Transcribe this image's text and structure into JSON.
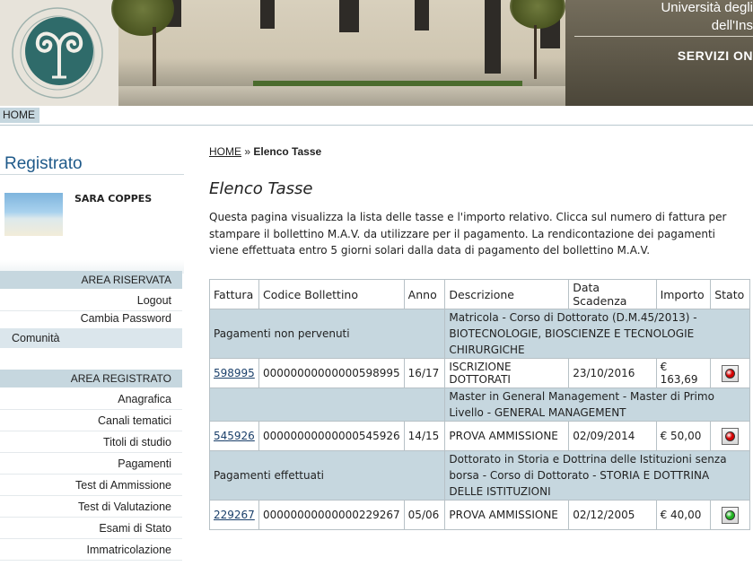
{
  "header": {
    "university_line1": "Università degli",
    "university_line2": "dell'Ins",
    "services_label": "SERVIZI ON"
  },
  "nav": {
    "home_tab": "HOME"
  },
  "sidebar": {
    "title": "Registrato",
    "user_name": "SARA COPPES",
    "area_riservata": {
      "heading": "AREA RISERVATA",
      "items": [
        "Logout",
        "Cambia Password"
      ]
    },
    "comunita": "Comunità",
    "area_registrato": {
      "heading": "AREA REGISTRATO",
      "items": [
        "Anagrafica",
        "Canali tematici",
        "Titoli di studio",
        "Pagamenti",
        "Test di Ammissione",
        "Test di Valutazione",
        "Esami di Stato",
        "Immatricolazione"
      ]
    }
  },
  "main": {
    "breadcrumb_home": "HOME",
    "breadcrumb_sep": "»",
    "breadcrumb_current": "Elenco Tasse",
    "title": "Elenco Tasse",
    "intro": "Questa pagina visualizza la lista delle tasse e l'importo relativo. Clicca sul numero di fattura per stampare il bollettino M.A.V. da utilizzare per il pagamento. La rendicontazione dei pagamenti viene effettuata entro 5 giorni solari dalla data di pagamento del bollettino M.A.V.",
    "table": {
      "headers": [
        "Fattura",
        "Codice Bollettino",
        "Anno",
        "Descrizione",
        "Data Scadenza",
        "Importo",
        "Stato"
      ],
      "groups": [
        {
          "status_label": "Pagamenti non pervenuti",
          "description": "Matricola - Corso di Dottorato (D.M.45/2013) - BIOTECNOLOGIE, BIOSCIENZE E TECNOLOGIE CHIRURGICHE",
          "row": {
            "fattura": "598995",
            "codice": "00000000000000598995",
            "anno": "16/17",
            "descrizione": "ISCRIZIONE DOTTORATI",
            "scadenza": "23/10/2016",
            "importo": "€ 163,69",
            "stato_color": "#d40000"
          }
        },
        {
          "status_label": "",
          "description": "Master in General Management - Master di Primo Livello - GENERAL MANAGEMENT",
          "row": {
            "fattura": "545926",
            "codice": "00000000000000545926",
            "anno": "14/15",
            "descrizione": "PROVA AMMISSIONE",
            "scadenza": "02/09/2014",
            "importo": "€ 50,00",
            "stato_color": "#d40000"
          }
        },
        {
          "status_label": "Pagamenti effettuati",
          "description": "Dottorato in Storia e Dottrina delle Istituzioni senza borsa - Corso di Dottorato - STORIA E DOTTRINA DELLE ISTITUZIONI",
          "row": {
            "fattura": "229267",
            "codice": "00000000000000229267",
            "anno": "05/06",
            "descrizione": "PROVA AMMISSIONE",
            "scadenza": "02/12/2005",
            "importo": "€ 40,00",
            "stato_color": "#1fb21f"
          }
        }
      ]
    }
  }
}
